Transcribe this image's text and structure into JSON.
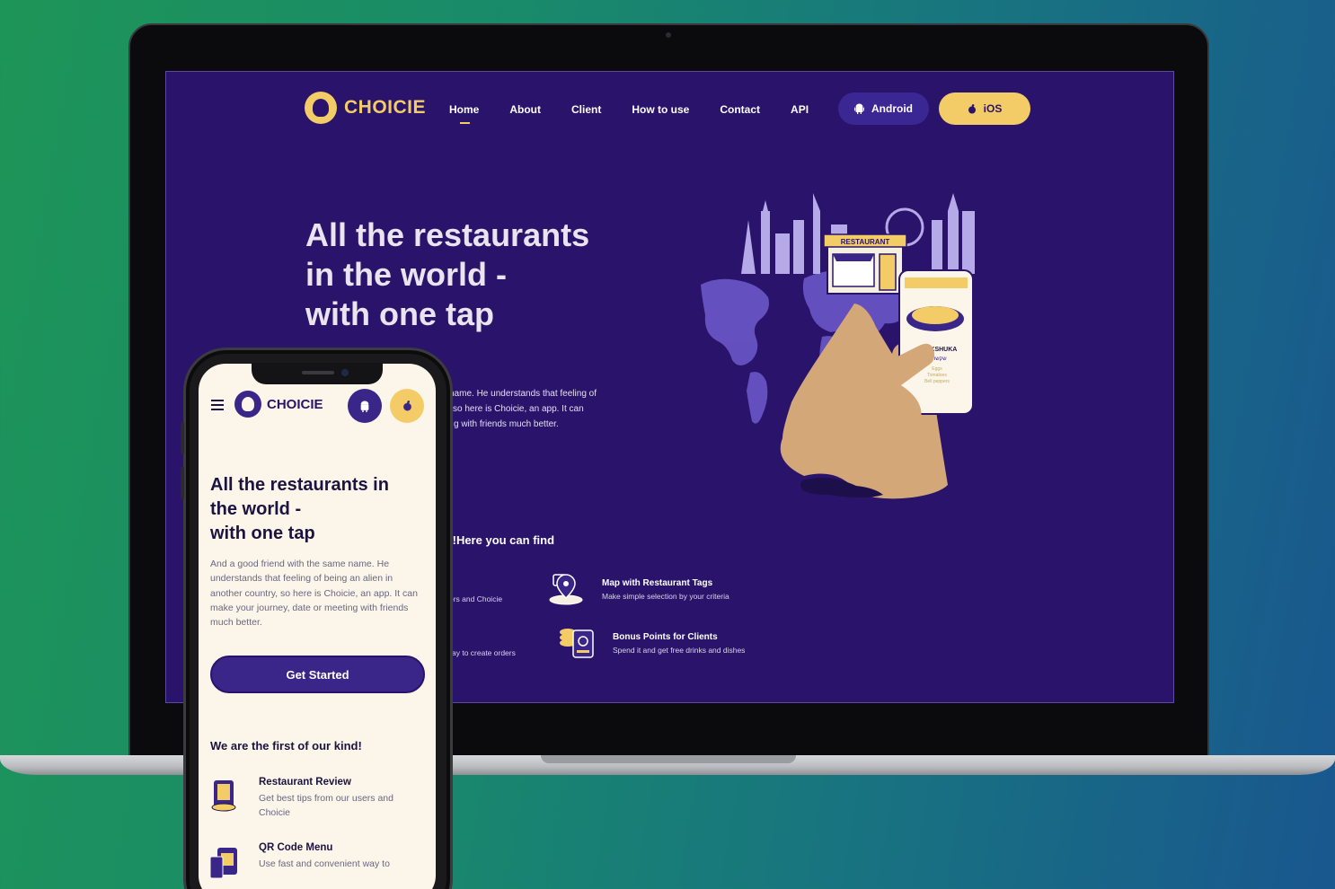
{
  "desktop": {
    "logo_text": "CHOICIE",
    "nav": [
      {
        "label": "Home",
        "active": true
      },
      {
        "label": "About"
      },
      {
        "label": "Client"
      },
      {
        "label": "How to use"
      },
      {
        "label": "Contact"
      },
      {
        "label": "API"
      }
    ],
    "android_label": "Android",
    "ios_label": "iOS",
    "hero_title_line1": "All the restaurants",
    "hero_title_line2": "in the world -",
    "hero_title_line3": "with one tap",
    "hero_text_line1": "name. He understands that feeling of",
    "hero_text_line2": "so here is Choicie, an app. It can",
    "hero_text_line3": "g with friends much better.",
    "section_title": "l!Here you can find",
    "features": [
      {
        "title": "",
        "desc": "ers and Choicie"
      },
      {
        "title": "Map with Restaurant Tags",
        "desc": "Make simple selection by your criteria"
      },
      {
        "title": "",
        "desc": "ay to create orders"
      },
      {
        "title": "Bonus Points for Clients",
        "desc": "Spend it and get free drinks and dishes"
      }
    ],
    "illustration": {
      "restaurant_sign": "RESTAURANT",
      "dish_name": "SHAKSHUKA",
      "dish_name_he": "שקשוקה",
      "ingredients": [
        "Eggs",
        "Tomatoes",
        "Bell peppers"
      ]
    }
  },
  "mobile": {
    "logo_text": "CHOICIE",
    "title_line1": "All the restaurants in",
    "title_line2": "the world -",
    "title_line3": "with one tap",
    "body": "And a good friend with the same name. He understands that feeling of being an alien in another country, so here is Choicie, an app. It can make your journey, date or meeting with friends much better.",
    "cta": "Get Started",
    "section_title": "We are the first of our kind!",
    "features": [
      {
        "title": "Restaurant Review",
        "desc": "Get best tips from our users and Choicie"
      },
      {
        "title": "QR Code Menu",
        "desc": "Use fast and convenient way to"
      }
    ]
  },
  "colors": {
    "brand_purple": "#2a146b",
    "accent_yellow": "#f3cc67",
    "mobile_bg": "#fbf6e9"
  }
}
